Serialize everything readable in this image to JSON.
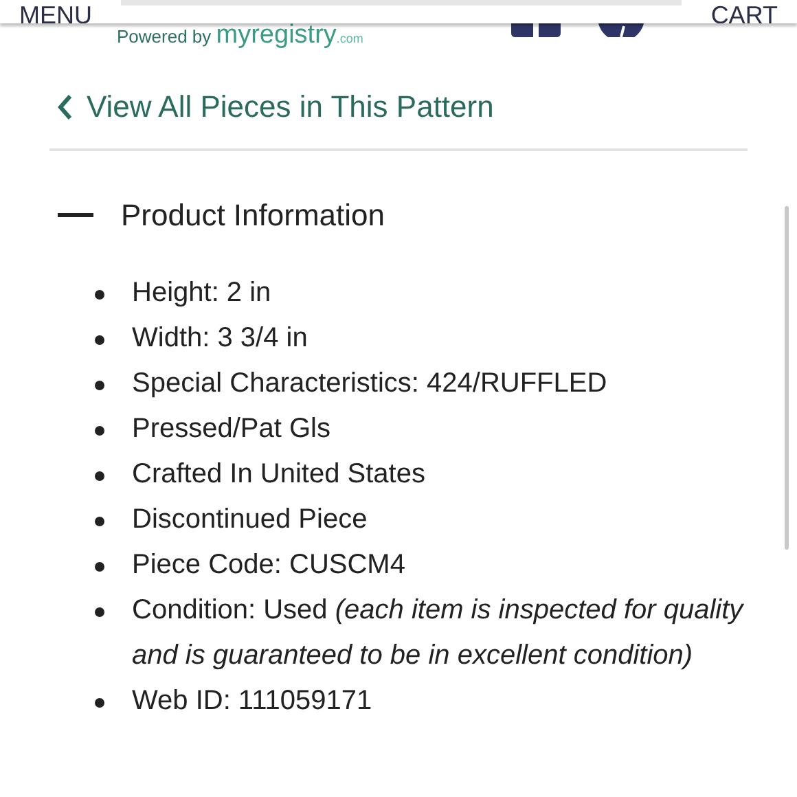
{
  "header": {
    "menu": "MENU",
    "cart": "CART"
  },
  "powered_by": {
    "prefix": "Powered by",
    "brand": "myregistry",
    "suffix": ".com"
  },
  "back_link": "View All Pieces in This Pattern",
  "section": {
    "title": "Product Information",
    "expanded": true,
    "items": [
      "Height: 2 in",
      "Width: 3 3/4 in",
      "Special Characteristics: 424/RUFFLED",
      "Pressed/Pat Gls",
      "Crafted In United States",
      "Discontinued Piece",
      "Piece Code: CUSCM4",
      "Condition: Used *(each item is inspected for quality and is guaranteed to be in excellent condition)*",
      "Web ID: 111059171"
    ]
  }
}
